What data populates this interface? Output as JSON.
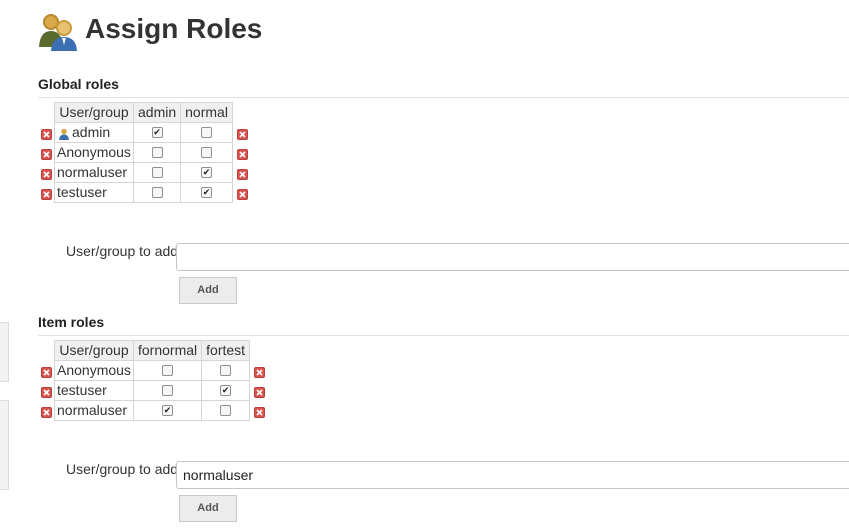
{
  "page": {
    "title": "Assign Roles",
    "icon": "user-group-icon"
  },
  "global": {
    "title": "Global roles",
    "headers": [
      "User/group",
      "admin",
      "normal"
    ],
    "rows": [
      {
        "name": "admin",
        "icon": "user-icon",
        "checks": [
          true,
          false
        ]
      },
      {
        "name": "Anonymous",
        "icon": "",
        "checks": [
          false,
          false
        ]
      },
      {
        "name": "normaluser",
        "icon": "",
        "checks": [
          false,
          true
        ]
      },
      {
        "name": "testuser",
        "icon": "",
        "checks": [
          false,
          true
        ]
      }
    ],
    "add_label": "User/group to add",
    "add_value": "",
    "add_button": "Add"
  },
  "item": {
    "title": "Item roles",
    "headers": [
      "User/group",
      "fornormal",
      "fortest"
    ],
    "rows": [
      {
        "name": "Anonymous",
        "icon": "",
        "checks": [
          false,
          false
        ]
      },
      {
        "name": "testuser",
        "icon": "",
        "checks": [
          false,
          true
        ]
      },
      {
        "name": "normaluser",
        "icon": "",
        "checks": [
          true,
          false
        ]
      }
    ],
    "add_label": "User/group to add",
    "add_value": "normaluser",
    "add_button": "Add"
  },
  "colors": {
    "delete_red": "#d9534f",
    "header_bg": "#f0f0f0"
  }
}
